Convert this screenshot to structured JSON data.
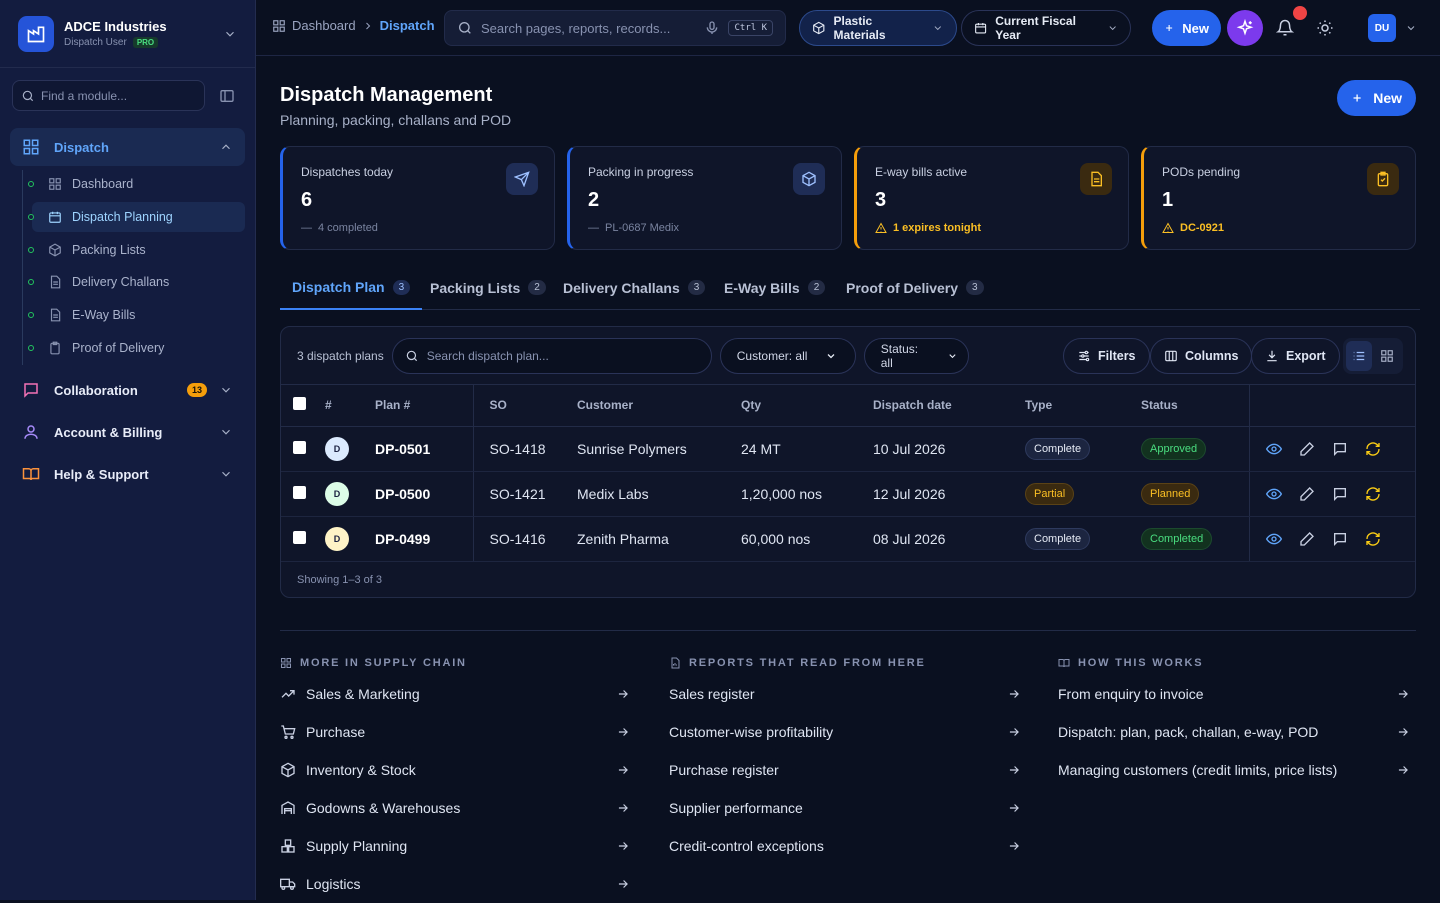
{
  "org": {
    "name": "ADCE Industries",
    "role": "Dispatch User",
    "plan_badge": "PRO"
  },
  "sidebar": {
    "search_placeholder": "Find a module...",
    "groups": [
      {
        "label": "Dispatch",
        "icon": "grid-icon"
      },
      {
        "label": "Collaboration",
        "icon": "chat-icon",
        "badge": "13"
      },
      {
        "label": "Account & Billing",
        "icon": "user-icon"
      },
      {
        "label": "Help & Support",
        "icon": "book-icon"
      }
    ],
    "dispatch_items": [
      {
        "label": "Dashboard",
        "icon": "grid-icon"
      },
      {
        "label": "Dispatch Planning",
        "icon": "calendar-icon"
      },
      {
        "label": "Packing Lists",
        "icon": "box-icon"
      },
      {
        "label": "Delivery Challans",
        "icon": "document-icon"
      },
      {
        "label": "E-Way Bills",
        "icon": "document-icon"
      },
      {
        "label": "Proof of Delivery",
        "icon": "clipboard-icon"
      }
    ]
  },
  "topbar": {
    "breadcrumb": [
      "Dashboard",
      "Dispatch"
    ],
    "search_placeholder": "Search pages, reports, records...",
    "shortcut": "Ctrl K",
    "division": "Plastic Materials",
    "period": "Current Fiscal Year",
    "new_label": "New",
    "user_initials": "DU"
  },
  "page": {
    "title": "Dispatch Management",
    "subtitle": "Planning, packing, challans and POD",
    "new_label": "New"
  },
  "stats": [
    {
      "title": "Dispatches today",
      "value": "6",
      "footer": "4 completed",
      "icon": "send-icon",
      "accent": "#2563eb",
      "warn": false
    },
    {
      "title": "Packing in progress",
      "value": "2",
      "footer": "PL-0687 Medix",
      "icon": "box-icon",
      "accent": "#2563eb",
      "warn": false
    },
    {
      "title": "E-way bills active",
      "value": "3",
      "footer": "1 expires tonight",
      "icon": "document-icon",
      "accent": "#f59e0b",
      "warn": true
    },
    {
      "title": "PODs pending",
      "value": "1",
      "footer": "DC-0921",
      "icon": "clipboard-icon",
      "accent": "#f59e0b",
      "warn": true
    }
  ],
  "tabs": [
    {
      "label": "Dispatch Plan",
      "count": "3"
    },
    {
      "label": "Packing Lists",
      "count": "2"
    },
    {
      "label": "Delivery Challans",
      "count": "3"
    },
    {
      "label": "E-Way Bills",
      "count": "2"
    },
    {
      "label": "Proof of Delivery",
      "count": "3"
    }
  ],
  "table": {
    "count_label": "3 dispatch plans",
    "search_placeholder": "Search dispatch plan...",
    "customer_filter": "Customer: all",
    "status_filter": "Status: all",
    "filters_label": "Filters",
    "columns_label": "Columns",
    "export_label": "Export",
    "headers": [
      "#",
      "Plan #",
      "SO",
      "Customer",
      "Qty",
      "Dispatch date",
      "Type",
      "Status"
    ],
    "rows": [
      {
        "avatar": "D",
        "avatar_color": "#dbeafe",
        "plan": "DP-0501",
        "so": "SO-1418",
        "customer": "Sunrise Polymers",
        "qty": "24 MT",
        "date": "10 Jul 2026",
        "type": "Complete",
        "status": "Approved",
        "status_kind": "approved",
        "type_kind": "type"
      },
      {
        "avatar": "D",
        "avatar_color": "#dcfce7",
        "plan": "DP-0500",
        "so": "SO-1421",
        "customer": "Medix Labs",
        "qty": "1,20,000 nos",
        "date": "12 Jul 2026",
        "type": "Partial",
        "status": "Planned",
        "status_kind": "planned",
        "type_kind": "partial"
      },
      {
        "avatar": "D",
        "avatar_color": "#fef3c7",
        "plan": "DP-0499",
        "so": "SO-1416",
        "customer": "Zenith Pharma",
        "qty": "60,000 nos",
        "date": "08 Jul 2026",
        "type": "Complete",
        "status": "Completed",
        "status_kind": "completed",
        "type_kind": "type"
      }
    ],
    "footer": "Showing 1–3 of 3"
  },
  "links": {
    "supply_chain": {
      "heading": "MORE IN SUPPLY CHAIN",
      "items": [
        {
          "label": "Sales & Marketing",
          "icon": "trend-icon"
        },
        {
          "label": "Purchase",
          "icon": "cart-icon"
        },
        {
          "label": "Inventory & Stock",
          "icon": "box-icon"
        },
        {
          "label": "Godowns & Warehouses",
          "icon": "warehouse-icon"
        },
        {
          "label": "Supply Planning",
          "icon": "boxes-icon"
        },
        {
          "label": "Logistics",
          "icon": "truck-icon"
        }
      ]
    },
    "reports": {
      "heading": "REPORTS THAT READ FROM HERE",
      "items": [
        "Sales register",
        "Customer-wise profitability",
        "Purchase register",
        "Supplier performance",
        "Credit-control exceptions"
      ]
    },
    "how": {
      "heading": "HOW THIS WORKS",
      "items": [
        "From enquiry to invoice",
        "Dispatch: plan, pack, challan, e-way, POD",
        "Managing customers (credit limits, price lists)"
      ]
    }
  }
}
